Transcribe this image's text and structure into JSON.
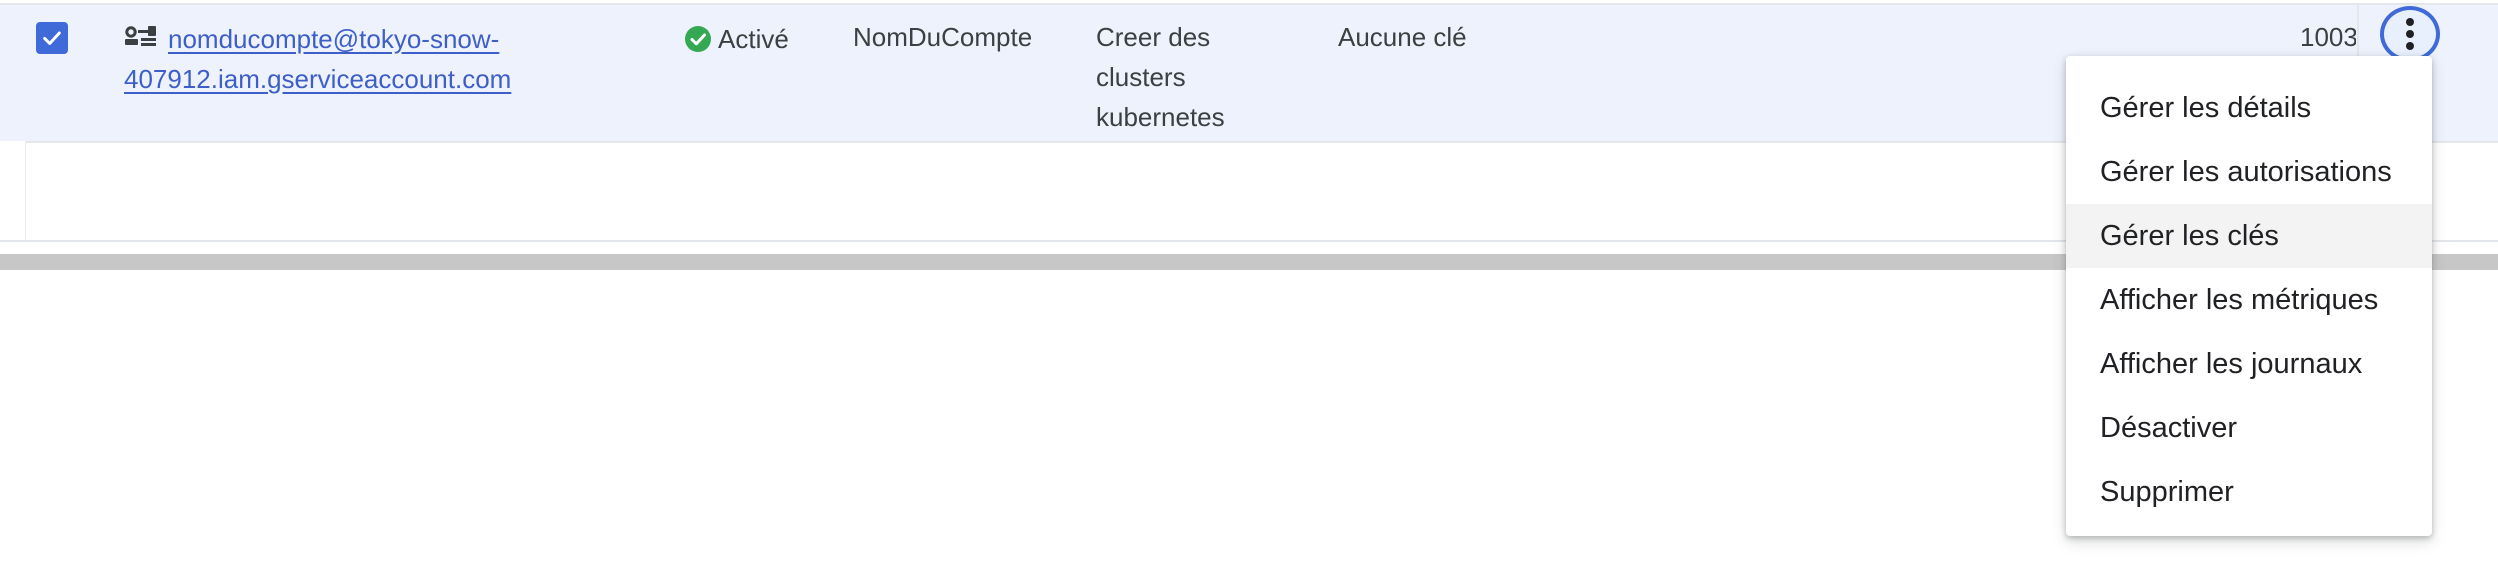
{
  "row": {
    "checked": true,
    "email_line1": "nomducompte@tokyo-snow-",
    "email_line2": "407912.iam.gserviceaccount.com",
    "status": "Activé",
    "name": "NomDuCompte",
    "description": "Creer des clusters kubernetes",
    "keys": "Aucune clé",
    "id_partial": "1003"
  },
  "icons": {
    "checkbox": "check-icon",
    "account": "service-account-icon",
    "status": "check-circle-icon",
    "more": "more-vert-icon"
  },
  "colors": {
    "accent": "#3f6ad8",
    "link": "#3d5fc7",
    "status_green": "#34a853",
    "row_selected_bg": "#edf2fc"
  },
  "menu": {
    "items": [
      "Gérer les détails",
      "Gérer les autorisations",
      "Gérer les clés",
      "Afficher les métriques",
      "Afficher les journaux",
      "Désactiver",
      "Supprimer"
    ],
    "highlighted_index": 2
  }
}
